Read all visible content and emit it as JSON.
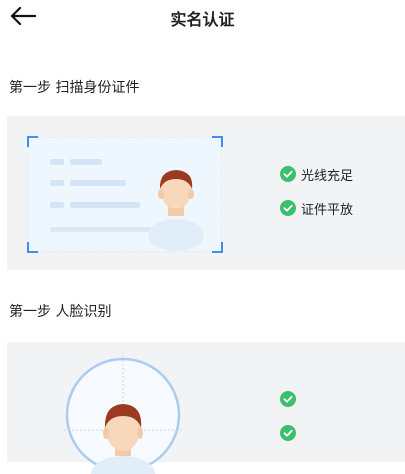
{
  "header": {
    "title": "实名认证",
    "back_icon": "arrow-left-icon"
  },
  "steps": [
    {
      "label": "第一步 扫描身份证件",
      "checks": [
        "光线充足",
        "证件平放"
      ]
    },
    {
      "label": "第一步 人脸识别",
      "checks": [
        "",
        ""
      ]
    }
  ],
  "colors": {
    "accent": "#3f8ff2",
    "check_green": "#3cbf6c",
    "card_bg": "#f2f3f5"
  }
}
